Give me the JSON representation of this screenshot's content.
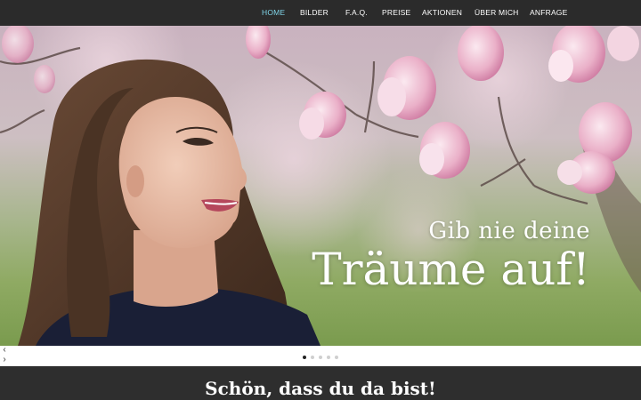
{
  "nav": {
    "items": [
      {
        "label": "HOME",
        "active": true
      },
      {
        "label": "BILDER",
        "active": false
      },
      {
        "label": "F.A.Q.",
        "active": false
      },
      {
        "label": "PREISE",
        "active": false
      },
      {
        "label": "AKTIONEN",
        "active": false
      },
      {
        "label": "ÜBER MICH",
        "active": false
      },
      {
        "label": "ANFRAGE",
        "active": false
      }
    ],
    "active_color": "#7fd3e6"
  },
  "hero": {
    "headline_line1": "Gib nie deine",
    "headline_line2": "Träume auf!",
    "image_subject": "portrait of smiling woman with magnolia blossoms"
  },
  "slider": {
    "prev_icon": "chevron-left-icon",
    "next_icon": "chevron-right-icon",
    "slide_count": 5,
    "active_slide": 1
  },
  "welcome": {
    "title": "Schön, dass du da bist!"
  }
}
